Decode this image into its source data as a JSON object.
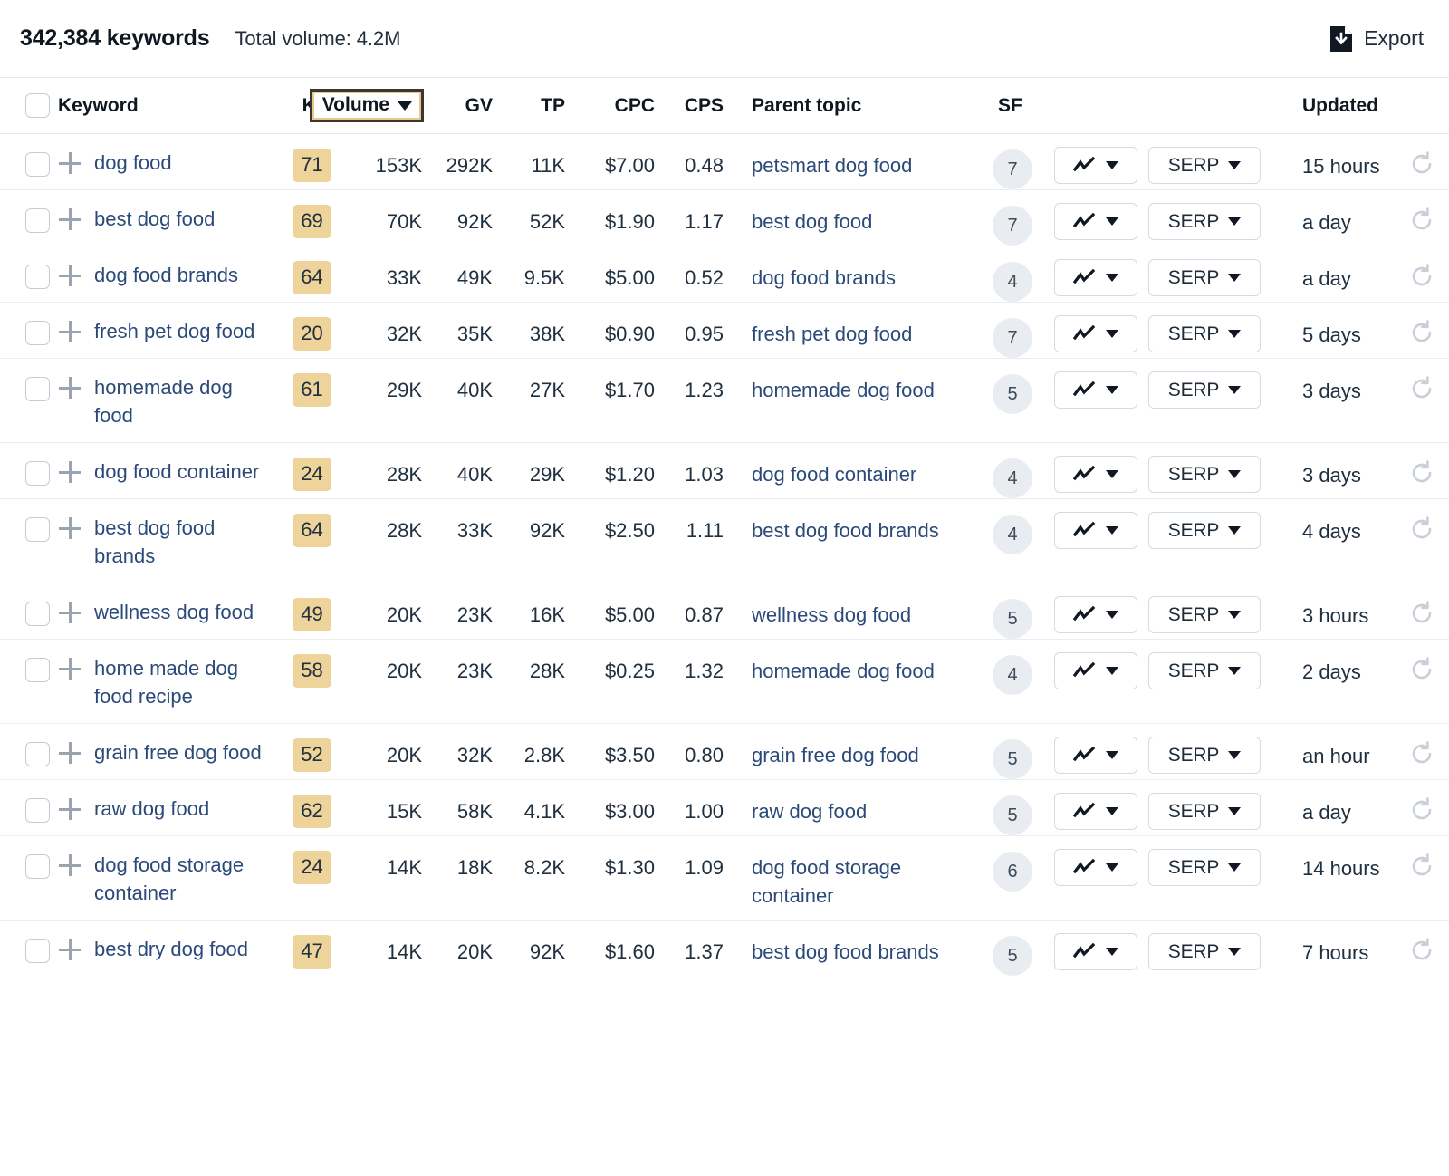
{
  "topbar": {
    "keyword_count": "342,384 keywords",
    "total_volume": "Total volume: 4.2M",
    "export_label": "Export",
    "export_icon": "file-download-icon"
  },
  "table": {
    "columns": {
      "keyword": "Keyword",
      "kd": "KD",
      "volume": "Volume",
      "gv": "GV",
      "tp": "TP",
      "cpc": "CPC",
      "cps": "CPS",
      "parent_topic": "Parent topic",
      "sf": "SF",
      "updated": "Updated"
    },
    "sorted_column": "Volume",
    "sort_direction": "desc",
    "row_actions": {
      "spark_label": "",
      "serp_label": "SERP"
    },
    "rows": [
      {
        "keyword": "dog food",
        "kd": "71",
        "volume": "153K",
        "gv": "292K",
        "tp": "11K",
        "cpc": "$7.00",
        "cps": "0.48",
        "parent_topic": "petsmart dog food",
        "sf": "7",
        "serp": "SERP",
        "updated": "15 hours"
      },
      {
        "keyword": "best dog food",
        "kd": "69",
        "volume": "70K",
        "gv": "92K",
        "tp": "52K",
        "cpc": "$1.90",
        "cps": "1.17",
        "parent_topic": "best dog food",
        "sf": "7",
        "serp": "SERP",
        "updated": "a day"
      },
      {
        "keyword": "dog food brands",
        "kd": "64",
        "volume": "33K",
        "gv": "49K",
        "tp": "9.5K",
        "cpc": "$5.00",
        "cps": "0.52",
        "parent_topic": "dog food brands",
        "sf": "4",
        "serp": "SERP",
        "updated": "a day"
      },
      {
        "keyword": "fresh pet dog food",
        "kd": "20",
        "volume": "32K",
        "gv": "35K",
        "tp": "38K",
        "cpc": "$0.90",
        "cps": "0.95",
        "parent_topic": "fresh pet dog food",
        "sf": "7",
        "serp": "SERP",
        "updated": "5 days"
      },
      {
        "keyword": "homemade dog food",
        "kd": "61",
        "volume": "29K",
        "gv": "40K",
        "tp": "27K",
        "cpc": "$1.70",
        "cps": "1.23",
        "parent_topic": "homemade dog food",
        "sf": "5",
        "serp": "SERP",
        "updated": "3 days"
      },
      {
        "keyword": "dog food container",
        "kd": "24",
        "volume": "28K",
        "gv": "40K",
        "tp": "29K",
        "cpc": "$1.20",
        "cps": "1.03",
        "parent_topic": "dog food container",
        "sf": "4",
        "serp": "SERP",
        "updated": "3 days"
      },
      {
        "keyword": "best dog food brands",
        "kd": "64",
        "volume": "28K",
        "gv": "33K",
        "tp": "92K",
        "cpc": "$2.50",
        "cps": "1.11",
        "parent_topic": "best dog food brands",
        "sf": "4",
        "serp": "SERP",
        "updated": "4 days"
      },
      {
        "keyword": "wellness dog food",
        "kd": "49",
        "volume": "20K",
        "gv": "23K",
        "tp": "16K",
        "cpc": "$5.00",
        "cps": "0.87",
        "parent_topic": "wellness dog food",
        "sf": "5",
        "serp": "SERP",
        "updated": "3 hours"
      },
      {
        "keyword": "home made dog food recipe",
        "kd": "58",
        "volume": "20K",
        "gv": "23K",
        "tp": "28K",
        "cpc": "$0.25",
        "cps": "1.32",
        "parent_topic": "homemade dog food",
        "sf": "4",
        "serp": "SERP",
        "updated": "2 days"
      },
      {
        "keyword": "grain free dog food",
        "kd": "52",
        "volume": "20K",
        "gv": "32K",
        "tp": "2.8K",
        "cpc": "$3.50",
        "cps": "0.80",
        "parent_topic": "grain free dog food",
        "sf": "5",
        "serp": "SERP",
        "updated": "an hour"
      },
      {
        "keyword": "raw dog food",
        "kd": "62",
        "volume": "15K",
        "gv": "58K",
        "tp": "4.1K",
        "cpc": "$3.00",
        "cps": "1.00",
        "parent_topic": "raw dog food",
        "sf": "5",
        "serp": "SERP",
        "updated": "a day"
      },
      {
        "keyword": "dog food storage container",
        "kd": "24",
        "volume": "14K",
        "gv": "18K",
        "tp": "8.2K",
        "cpc": "$1.30",
        "cps": "1.09",
        "parent_topic": "dog food storage container",
        "sf": "6",
        "serp": "SERP",
        "updated": "14 hours"
      },
      {
        "keyword": "best dry dog food",
        "kd": "47",
        "volume": "14K",
        "gv": "20K",
        "tp": "92K",
        "cpc": "$1.60",
        "cps": "1.37",
        "parent_topic": "best dog food brands",
        "sf": "5",
        "serp": "SERP",
        "updated": "7 hours"
      }
    ]
  },
  "colors": {
    "kd_badge_bg": "#eed39a",
    "link": "#2b4a7a",
    "text": "#20303f",
    "border": "#e9ecf0",
    "sf_pill_bg": "#e9ecf1",
    "focus_outline": "#e7c98d",
    "focus_border": "#3a3630"
  }
}
